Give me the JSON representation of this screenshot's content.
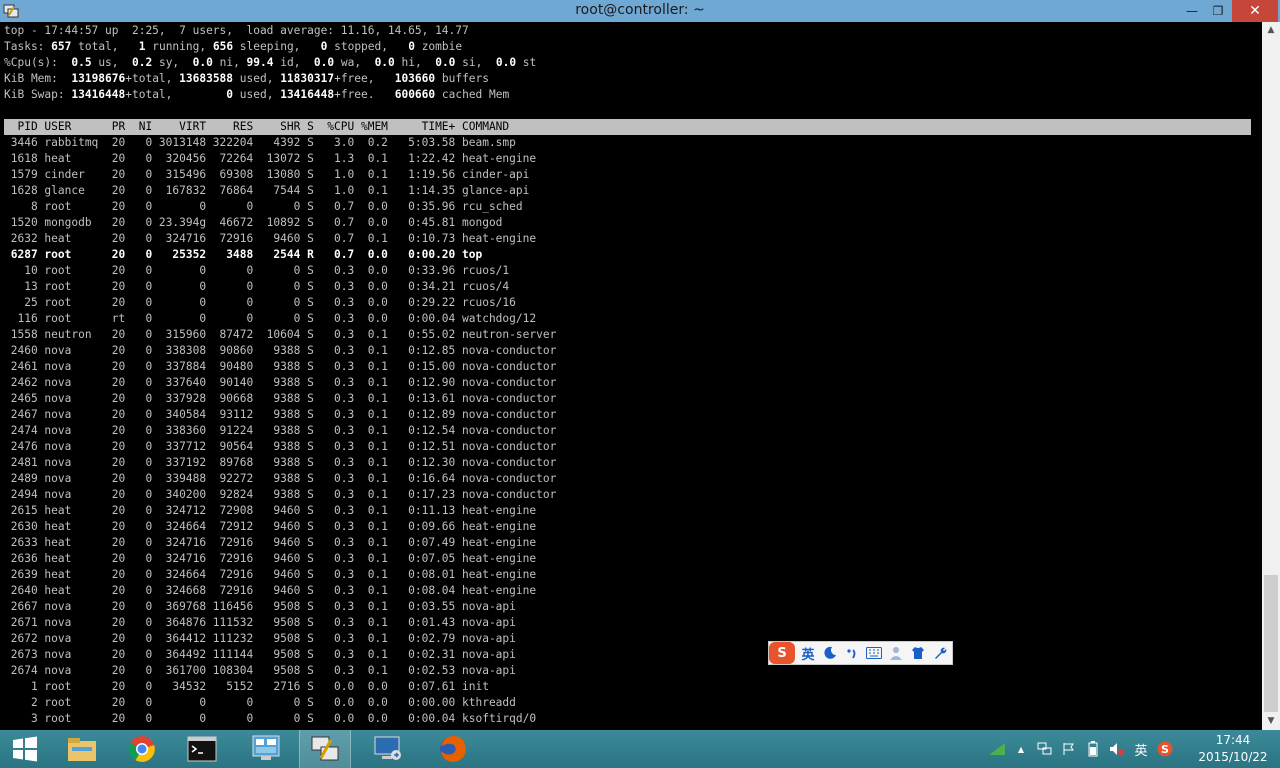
{
  "window": {
    "title": "root@controller: ~",
    "minimize_glyph": "—",
    "maximize_glyph": "❐",
    "close_glyph": "✕"
  },
  "top_summary": [
    {
      "parts": [
        {
          "t": "top - 17:44:57 up  2:25,  7 users,  load average: 11.16, 14.65, 14.77"
        }
      ]
    },
    {
      "parts": [
        {
          "t": "Tasks: "
        },
        {
          "t": "657",
          "b": true
        },
        {
          "t": " total,   "
        },
        {
          "t": "1",
          "b": true
        },
        {
          "t": " running, "
        },
        {
          "t": "656",
          "b": true
        },
        {
          "t": " sleeping,   "
        },
        {
          "t": "0",
          "b": true
        },
        {
          "t": " stopped,   "
        },
        {
          "t": "0",
          "b": true
        },
        {
          "t": " zombie"
        }
      ]
    },
    {
      "parts": [
        {
          "t": "%Cpu(s):  "
        },
        {
          "t": "0.5",
          "b": true
        },
        {
          "t": " us,  "
        },
        {
          "t": "0.2",
          "b": true
        },
        {
          "t": " sy,  "
        },
        {
          "t": "0.0",
          "b": true
        },
        {
          "t": " ni, "
        },
        {
          "t": "99.4",
          "b": true
        },
        {
          "t": " id,  "
        },
        {
          "t": "0.0",
          "b": true
        },
        {
          "t": " wa,  "
        },
        {
          "t": "0.0",
          "b": true
        },
        {
          "t": " hi,  "
        },
        {
          "t": "0.0",
          "b": true
        },
        {
          "t": " si,  "
        },
        {
          "t": "0.0",
          "b": true
        },
        {
          "t": " st"
        }
      ]
    },
    {
      "parts": [
        {
          "t": "KiB Mem:  "
        },
        {
          "t": "13198676",
          "b": true
        },
        {
          "t": "+total, "
        },
        {
          "t": "13683588",
          "b": true
        },
        {
          "t": " used, "
        },
        {
          "t": "11830317",
          "b": true
        },
        {
          "t": "+free,   "
        },
        {
          "t": "103660",
          "b": true
        },
        {
          "t": " buffers"
        }
      ]
    },
    {
      "parts": [
        {
          "t": "KiB Swap: "
        },
        {
          "t": "13416448",
          "b": true
        },
        {
          "t": "+total,        "
        },
        {
          "t": "0",
          "b": true
        },
        {
          "t": " used, "
        },
        {
          "t": "13416448",
          "b": true
        },
        {
          "t": "+free.   "
        },
        {
          "t": "600660",
          "b": true
        },
        {
          "t": " cached Mem"
        }
      ]
    }
  ],
  "process_header": "  PID USER      PR  NI    VIRT    RES    SHR S  %CPU %MEM     TIME+ COMMAND",
  "processes": [
    {
      "pid": "3446",
      "user": "rabbitmq",
      "pr": "20",
      "ni": "0",
      "virt": "3013148",
      "res": "322204",
      "shr": "4392",
      "s": "S",
      "cpu": "3.0",
      "mem": "0.2",
      "time": "5:03.58",
      "cmd": "beam.smp"
    },
    {
      "pid": "1618",
      "user": "heat",
      "pr": "20",
      "ni": "0",
      "virt": "320456",
      "res": "72264",
      "shr": "13072",
      "s": "S",
      "cpu": "1.3",
      "mem": "0.1",
      "time": "1:22.42",
      "cmd": "heat-engine"
    },
    {
      "pid": "1579",
      "user": "cinder",
      "pr": "20",
      "ni": "0",
      "virt": "315496",
      "res": "69308",
      "shr": "13080",
      "s": "S",
      "cpu": "1.0",
      "mem": "0.1",
      "time": "1:19.56",
      "cmd": "cinder-api"
    },
    {
      "pid": "1628",
      "user": "glance",
      "pr": "20",
      "ni": "0",
      "virt": "167832",
      "res": "76864",
      "shr": "7544",
      "s": "S",
      "cpu": "1.0",
      "mem": "0.1",
      "time": "1:14.35",
      "cmd": "glance-api"
    },
    {
      "pid": "8",
      "user": "root",
      "pr": "20",
      "ni": "0",
      "virt": "0",
      "res": "0",
      "shr": "0",
      "s": "S",
      "cpu": "0.7",
      "mem": "0.0",
      "time": "0:35.96",
      "cmd": "rcu_sched"
    },
    {
      "pid": "1520",
      "user": "mongodb",
      "pr": "20",
      "ni": "0",
      "virt": "23.394g",
      "res": "46672",
      "shr": "10892",
      "s": "S",
      "cpu": "0.7",
      "mem": "0.0",
      "time": "0:45.81",
      "cmd": "mongod"
    },
    {
      "pid": "2632",
      "user": "heat",
      "pr": "20",
      "ni": "0",
      "virt": "324716",
      "res": "72916",
      "shr": "9460",
      "s": "S",
      "cpu": "0.7",
      "mem": "0.1",
      "time": "0:10.73",
      "cmd": "heat-engine"
    },
    {
      "pid": "6287",
      "user": "root",
      "pr": "20",
      "ni": "0",
      "virt": "25352",
      "res": "3488",
      "shr": "2544",
      "s": "R",
      "cpu": "0.7",
      "mem": "0.0",
      "time": "0:00.20",
      "cmd": "top",
      "bold": true
    },
    {
      "pid": "10",
      "user": "root",
      "pr": "20",
      "ni": "0",
      "virt": "0",
      "res": "0",
      "shr": "0",
      "s": "S",
      "cpu": "0.3",
      "mem": "0.0",
      "time": "0:33.96",
      "cmd": "rcuos/1"
    },
    {
      "pid": "13",
      "user": "root",
      "pr": "20",
      "ni": "0",
      "virt": "0",
      "res": "0",
      "shr": "0",
      "s": "S",
      "cpu": "0.3",
      "mem": "0.0",
      "time": "0:34.21",
      "cmd": "rcuos/4"
    },
    {
      "pid": "25",
      "user": "root",
      "pr": "20",
      "ni": "0",
      "virt": "0",
      "res": "0",
      "shr": "0",
      "s": "S",
      "cpu": "0.3",
      "mem": "0.0",
      "time": "0:29.22",
      "cmd": "rcuos/16"
    },
    {
      "pid": "116",
      "user": "root",
      "pr": "rt",
      "ni": "0",
      "virt": "0",
      "res": "0",
      "shr": "0",
      "s": "S",
      "cpu": "0.3",
      "mem": "0.0",
      "time": "0:00.04",
      "cmd": "watchdog/12"
    },
    {
      "pid": "1558",
      "user": "neutron",
      "pr": "20",
      "ni": "0",
      "virt": "315960",
      "res": "87472",
      "shr": "10604",
      "s": "S",
      "cpu": "0.3",
      "mem": "0.1",
      "time": "0:55.02",
      "cmd": "neutron-server"
    },
    {
      "pid": "2460",
      "user": "nova",
      "pr": "20",
      "ni": "0",
      "virt": "338308",
      "res": "90860",
      "shr": "9388",
      "s": "S",
      "cpu": "0.3",
      "mem": "0.1",
      "time": "0:12.85",
      "cmd": "nova-conductor"
    },
    {
      "pid": "2461",
      "user": "nova",
      "pr": "20",
      "ni": "0",
      "virt": "337884",
      "res": "90480",
      "shr": "9388",
      "s": "S",
      "cpu": "0.3",
      "mem": "0.1",
      "time": "0:15.00",
      "cmd": "nova-conductor"
    },
    {
      "pid": "2462",
      "user": "nova",
      "pr": "20",
      "ni": "0",
      "virt": "337640",
      "res": "90140",
      "shr": "9388",
      "s": "S",
      "cpu": "0.3",
      "mem": "0.1",
      "time": "0:12.90",
      "cmd": "nova-conductor"
    },
    {
      "pid": "2465",
      "user": "nova",
      "pr": "20",
      "ni": "0",
      "virt": "337928",
      "res": "90668",
      "shr": "9388",
      "s": "S",
      "cpu": "0.3",
      "mem": "0.1",
      "time": "0:13.61",
      "cmd": "nova-conductor"
    },
    {
      "pid": "2467",
      "user": "nova",
      "pr": "20",
      "ni": "0",
      "virt": "340584",
      "res": "93112",
      "shr": "9388",
      "s": "S",
      "cpu": "0.3",
      "mem": "0.1",
      "time": "0:12.89",
      "cmd": "nova-conductor"
    },
    {
      "pid": "2474",
      "user": "nova",
      "pr": "20",
      "ni": "0",
      "virt": "338360",
      "res": "91224",
      "shr": "9388",
      "s": "S",
      "cpu": "0.3",
      "mem": "0.1",
      "time": "0:12.54",
      "cmd": "nova-conductor"
    },
    {
      "pid": "2476",
      "user": "nova",
      "pr": "20",
      "ni": "0",
      "virt": "337712",
      "res": "90564",
      "shr": "9388",
      "s": "S",
      "cpu": "0.3",
      "mem": "0.1",
      "time": "0:12.51",
      "cmd": "nova-conductor"
    },
    {
      "pid": "2481",
      "user": "nova",
      "pr": "20",
      "ni": "0",
      "virt": "337192",
      "res": "89768",
      "shr": "9388",
      "s": "S",
      "cpu": "0.3",
      "mem": "0.1",
      "time": "0:12.30",
      "cmd": "nova-conductor"
    },
    {
      "pid": "2489",
      "user": "nova",
      "pr": "20",
      "ni": "0",
      "virt": "339488",
      "res": "92272",
      "shr": "9388",
      "s": "S",
      "cpu": "0.3",
      "mem": "0.1",
      "time": "0:16.64",
      "cmd": "nova-conductor"
    },
    {
      "pid": "2494",
      "user": "nova",
      "pr": "20",
      "ni": "0",
      "virt": "340200",
      "res": "92824",
      "shr": "9388",
      "s": "S",
      "cpu": "0.3",
      "mem": "0.1",
      "time": "0:17.23",
      "cmd": "nova-conductor"
    },
    {
      "pid": "2615",
      "user": "heat",
      "pr": "20",
      "ni": "0",
      "virt": "324712",
      "res": "72908",
      "shr": "9460",
      "s": "S",
      "cpu": "0.3",
      "mem": "0.1",
      "time": "0:11.13",
      "cmd": "heat-engine"
    },
    {
      "pid": "2630",
      "user": "heat",
      "pr": "20",
      "ni": "0",
      "virt": "324664",
      "res": "72912",
      "shr": "9460",
      "s": "S",
      "cpu": "0.3",
      "mem": "0.1",
      "time": "0:09.66",
      "cmd": "heat-engine"
    },
    {
      "pid": "2633",
      "user": "heat",
      "pr": "20",
      "ni": "0",
      "virt": "324716",
      "res": "72916",
      "shr": "9460",
      "s": "S",
      "cpu": "0.3",
      "mem": "0.1",
      "time": "0:07.49",
      "cmd": "heat-engine"
    },
    {
      "pid": "2636",
      "user": "heat",
      "pr": "20",
      "ni": "0",
      "virt": "324716",
      "res": "72916",
      "shr": "9460",
      "s": "S",
      "cpu": "0.3",
      "mem": "0.1",
      "time": "0:07.05",
      "cmd": "heat-engine"
    },
    {
      "pid": "2639",
      "user": "heat",
      "pr": "20",
      "ni": "0",
      "virt": "324664",
      "res": "72916",
      "shr": "9460",
      "s": "S",
      "cpu": "0.3",
      "mem": "0.1",
      "time": "0:08.01",
      "cmd": "heat-engine"
    },
    {
      "pid": "2640",
      "user": "heat",
      "pr": "20",
      "ni": "0",
      "virt": "324668",
      "res": "72916",
      "shr": "9460",
      "s": "S",
      "cpu": "0.3",
      "mem": "0.1",
      "time": "0:08.04",
      "cmd": "heat-engine"
    },
    {
      "pid": "2667",
      "user": "nova",
      "pr": "20",
      "ni": "0",
      "virt": "369768",
      "res": "116456",
      "shr": "9508",
      "s": "S",
      "cpu": "0.3",
      "mem": "0.1",
      "time": "0:03.55",
      "cmd": "nova-api"
    },
    {
      "pid": "2671",
      "user": "nova",
      "pr": "20",
      "ni": "0",
      "virt": "364876",
      "res": "111532",
      "shr": "9508",
      "s": "S",
      "cpu": "0.3",
      "mem": "0.1",
      "time": "0:01.43",
      "cmd": "nova-api"
    },
    {
      "pid": "2672",
      "user": "nova",
      "pr": "20",
      "ni": "0",
      "virt": "364412",
      "res": "111232",
      "shr": "9508",
      "s": "S",
      "cpu": "0.3",
      "mem": "0.1",
      "time": "0:02.79",
      "cmd": "nova-api"
    },
    {
      "pid": "2673",
      "user": "nova",
      "pr": "20",
      "ni": "0",
      "virt": "364492",
      "res": "111144",
      "shr": "9508",
      "s": "S",
      "cpu": "0.3",
      "mem": "0.1",
      "time": "0:02.31",
      "cmd": "nova-api"
    },
    {
      "pid": "2674",
      "user": "nova",
      "pr": "20",
      "ni": "0",
      "virt": "361700",
      "res": "108304",
      "shr": "9508",
      "s": "S",
      "cpu": "0.3",
      "mem": "0.1",
      "time": "0:02.53",
      "cmd": "nova-api"
    },
    {
      "pid": "1",
      "user": "root",
      "pr": "20",
      "ni": "0",
      "virt": "34532",
      "res": "5152",
      "shr": "2716",
      "s": "S",
      "cpu": "0.0",
      "mem": "0.0",
      "time": "0:07.61",
      "cmd": "init"
    },
    {
      "pid": "2",
      "user": "root",
      "pr": "20",
      "ni": "0",
      "virt": "0",
      "res": "0",
      "shr": "0",
      "s": "S",
      "cpu": "0.0",
      "mem": "0.0",
      "time": "0:00.00",
      "cmd": "kthreadd"
    },
    {
      "pid": "3",
      "user": "root",
      "pr": "20",
      "ni": "0",
      "virt": "0",
      "res": "0",
      "shr": "0",
      "s": "S",
      "cpu": "0.0",
      "mem": "0.0",
      "time": "0:00.04",
      "cmd": "ksoftirqd/0"
    }
  ],
  "scrollbar": {
    "up_glyph": "▲",
    "down_glyph": "▼",
    "position_fraction": 0.82
  },
  "ime": {
    "logo_glyph": "S",
    "lang_label": "英",
    "items": [
      "moon-icon",
      "punctuation-icon",
      "keyboard-icon",
      "user-icon",
      "shirt-icon",
      "wrench-icon"
    ]
  },
  "taskbar": {
    "items": [
      "start-button",
      "file-explorer",
      "chrome",
      "command-prompt",
      "remote-desktop-manager",
      "putty",
      "remote-desktop-connection",
      "firefox"
    ],
    "active_item": "putty",
    "tray": {
      "show_hidden_glyph": "▲",
      "ime_lang": "英",
      "clock_time": "17:44",
      "clock_date": "2015/10/22"
    }
  },
  "colors": {
    "titlebar": "#6fa8d3",
    "close_button": "#c7463a",
    "terminal_bg": "#000000",
    "terminal_fg": "#c0c0c0",
    "header_bg": "#c0c0c0",
    "taskbar": "#2f7c8b",
    "ime_logo": "#e8532b"
  }
}
